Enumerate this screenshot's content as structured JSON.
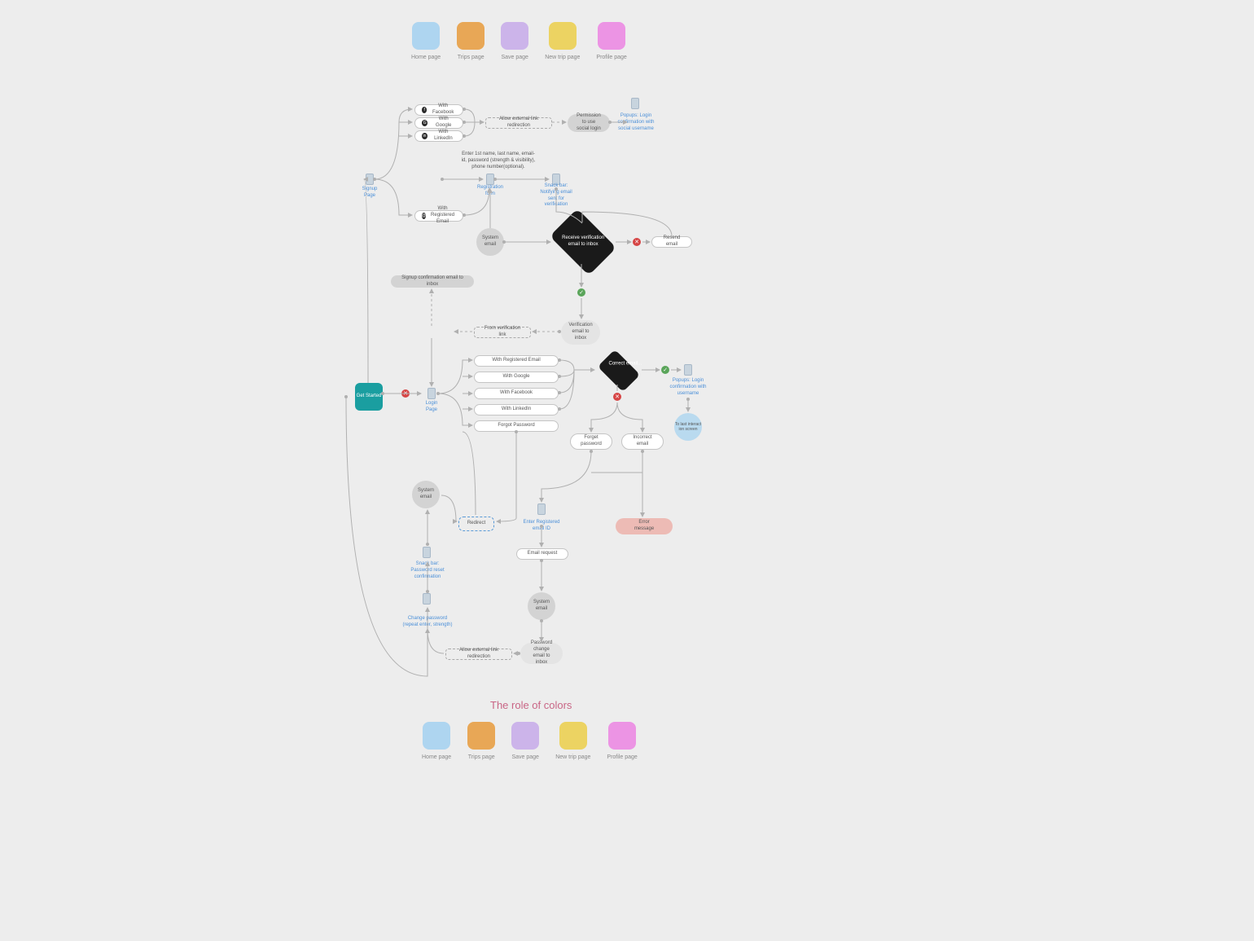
{
  "legend": {
    "items": [
      {
        "label": "Home page",
        "color": "sw-blue"
      },
      {
        "label": "Trips page",
        "color": "sw-orange"
      },
      {
        "label": "Save page",
        "color": "sw-lilac"
      },
      {
        "label": "New trip page",
        "color": "sw-yellow"
      },
      {
        "label": "Profile page",
        "color": "sw-pink"
      }
    ]
  },
  "title": "The role of colors",
  "nodes": {
    "get_started": "Get Started",
    "signup_page": "Signup Page",
    "login_page": "Login Page",
    "with_facebook": "With Facebook",
    "with_google": "With Google",
    "with_linkedin": "With LinkedIn",
    "with_registered_email": "With Registered Email",
    "allow_ext_redirect": "Allow external link redirection",
    "permission_social": "Permission to use social login",
    "popup_social": "Popups: Login confirmation with social username",
    "regform_note": "Enter 1st name, last name, email-id, password (strength & visibility), phone number(optional).",
    "registration_form": "Registration form",
    "snackbar_verify": "Snack bar: Notifying email sent for verification",
    "system_email": "System email",
    "receive_verify": "Receive verification email to inbox",
    "resend_email": "Resend email",
    "signup_confirm": "Signup confirmation email to inbox",
    "verification_email": "Verification email to inbox",
    "from_verify_link": "From verification link",
    "login_reg_email": "With Registered Email",
    "login_google": "With Google",
    "login_facebook": "With Facebook",
    "login_linkedin": "With LinkedIn",
    "forgot_password": "Forgot Password",
    "correct_email": "Correct email...",
    "popup_login": "Popups: Login confirmation with username",
    "to_last_interact": "To last interact ion screen",
    "forget_password": "Forget password",
    "incorrect_email": "Incorrect email",
    "error_message": "Error message",
    "redirect": "Redirect",
    "enter_reg_email": "Enter Registered email ID",
    "email_request": "Email request",
    "system_email2": "System email",
    "snackbar_reset": "Snack bar: Password reset confirmation",
    "change_password": "Change password (repeat enter, strength)",
    "allow_ext_redirect2": "Allow external link redirection",
    "pw_change_email": "Password change email to inbox",
    "system_email3": "System email"
  }
}
